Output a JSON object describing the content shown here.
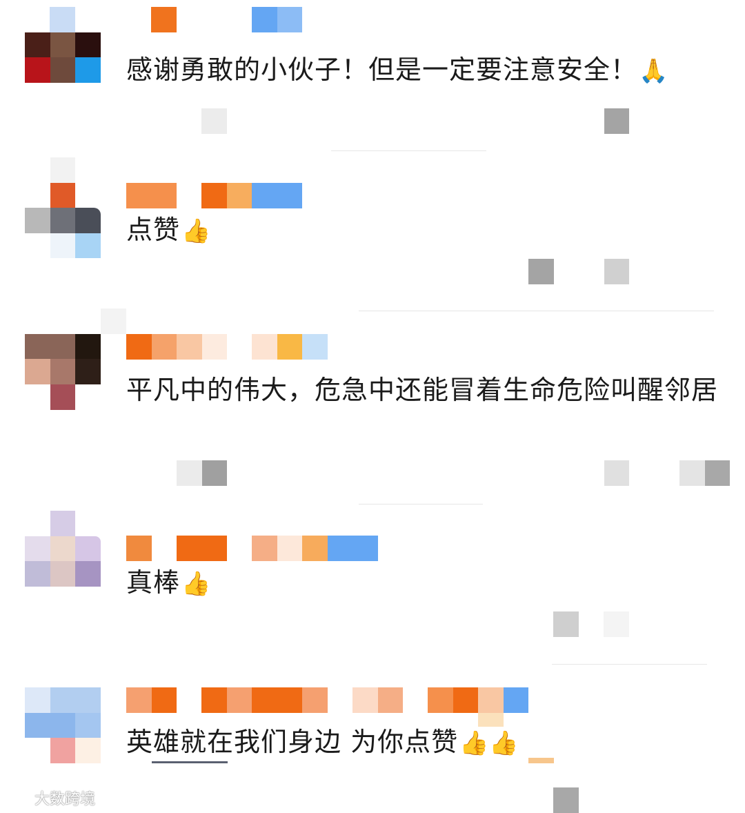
{
  "comments": [
    {
      "text": "感谢勇敢的小伙子！但是一定要注意安全！",
      "emoji": "🙏"
    },
    {
      "text": "点赞",
      "emoji": "👍"
    },
    {
      "text": "平凡中的伟大，危急中还能冒着生命危险叫醒邻居",
      "emoji": ""
    },
    {
      "text": "真棒",
      "emoji": "👍"
    },
    {
      "text": "英雄就在我们身边  为你点赞",
      "emoji": "👍👍"
    }
  ],
  "watermark": {
    "text": "大数跨境"
  },
  "colors": {
    "username_orange": "#f0731e",
    "username_light": "#f5a26a",
    "username_blue": "#6aaaf2",
    "meta_gray": "#a8a8a8",
    "divider": "#e6e6e6"
  }
}
